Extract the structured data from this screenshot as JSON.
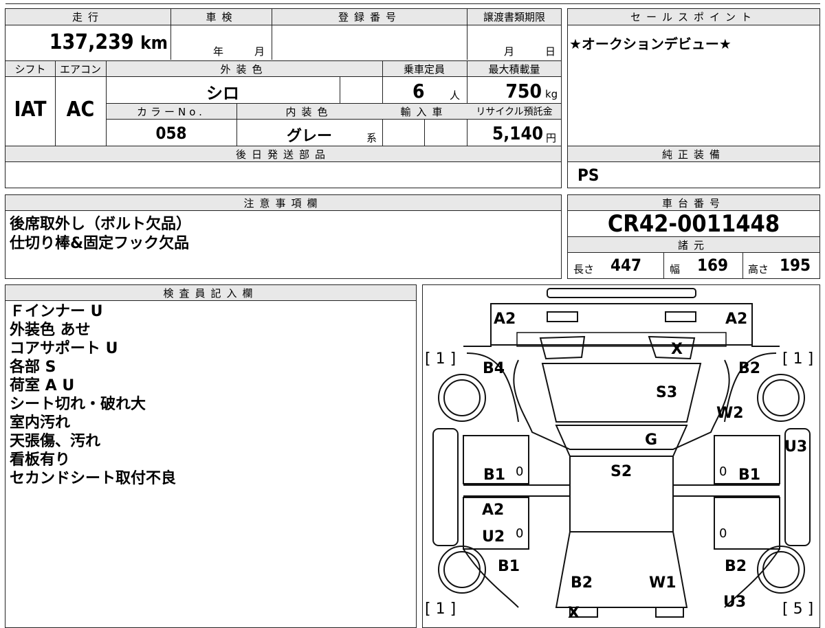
{
  "mileage": {
    "label": "走行",
    "value": "137,239",
    "unit": "km"
  },
  "inspection": {
    "label": "車検",
    "year": "年",
    "month": "月"
  },
  "registration": {
    "label": "登録番号",
    "value": ""
  },
  "transfer_deadline": {
    "label": "譲渡書類期限",
    "month": "月",
    "day": "日"
  },
  "sales_point": {
    "label": "セールスポイント",
    "value": "★オークションデビュー★"
  },
  "shift": {
    "label": "シフト",
    "value": "IAT"
  },
  "aircon": {
    "label": "エアコン",
    "value": "AC"
  },
  "exterior_color": {
    "label": "外装色",
    "value": "シロ"
  },
  "capacity": {
    "label": "乗車定員",
    "value": "6",
    "unit": "人"
  },
  "max_load": {
    "label": "最大積載量",
    "value": "750",
    "unit": "kg"
  },
  "color_no": {
    "label": "カラーNo.",
    "value": "058"
  },
  "interior_color": {
    "label": "内装色",
    "value": "グレー",
    "suffix": "系"
  },
  "import": {
    "label": "輸入車"
  },
  "recycle_fee": {
    "label": "リサイクル預託金",
    "value": "5,140",
    "unit": "円"
  },
  "later_parts": {
    "label": "後日発送部品",
    "value": ""
  },
  "genuine_equipment": {
    "label": "純正装備",
    "value": "PS"
  },
  "notes": {
    "label": "注意事項欄",
    "line1": "後席取外し（ボルト欠品）",
    "line2": "仕切り棒&固定フック欠品"
  },
  "chassis_no": {
    "label": "車台番号",
    "value": "CR42-0011448"
  },
  "specs": {
    "label": "諸元",
    "length_label": "長さ",
    "length": "447",
    "width_label": "幅",
    "width": "169",
    "height_label": "高さ",
    "height": "195"
  },
  "inspector": {
    "label": "検査員記入欄",
    "lines": [
      "Ｆインナー U",
      "外装色 あせ",
      "コアサポート U",
      "各部 S",
      "荷室 A U",
      "シート切れ・破れ大",
      "室内汚れ",
      "天張傷、汚れ",
      "看板有り",
      "セカンドシート取付不良"
    ]
  },
  "diagram": {
    "labels": {
      "a2_left": "A2",
      "a2_right": "A2",
      "x_top": "X",
      "b4": "B4",
      "b2_top": "B2",
      "s3": "S3",
      "w2": "W2",
      "g": "G",
      "u3_right": "U3",
      "b1_left": "B1",
      "b1_right": "B1",
      "s2": "S2",
      "a2_mid": "A2",
      "u2": "U2",
      "b1_low_left": "B1",
      "b2_low_right": "B2",
      "b2_bottom": "B2",
      "w1": "W1",
      "u3_bottom": "U3",
      "x_bottom": "X",
      "zero1": "0",
      "zero2": "0",
      "zero3": "0",
      "zero4": "0"
    },
    "brackets": {
      "top_left": "[ 1 ]",
      "top_right": "[ 1 ]",
      "bottom_left": "[ 1 ]",
      "bottom_right": "[ 5 ]"
    }
  }
}
